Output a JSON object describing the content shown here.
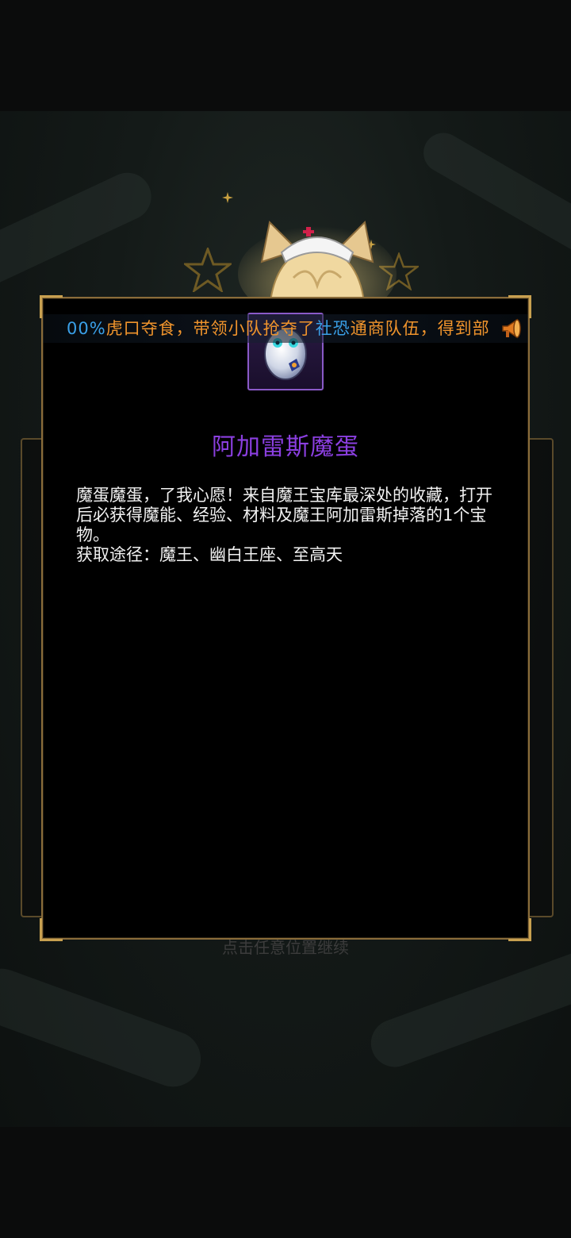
{
  "notice": {
    "segment_1": "00%",
    "segment_2": "虎口夺食，带领小队抢夺了",
    "segment_3": "社恐",
    "segment_4": "通商队伍，得到部",
    "colors": {
      "blue": "#3aa0e8",
      "orange": "#f0942c"
    }
  },
  "item": {
    "icon": "demon-egg-icon",
    "name": "阿加雷斯魔蛋",
    "name_color": "#8b3fe0",
    "description": "魔蛋魔蛋，了我心愿！来自魔王宝库最深处的收藏，打开后必获得魔能、经验、材料及魔王阿加雷斯掉落的1个宝物。",
    "source": "获取途径：魔王、幽白王座、至高天"
  },
  "background": {
    "hint": "点击任意位置继续"
  }
}
